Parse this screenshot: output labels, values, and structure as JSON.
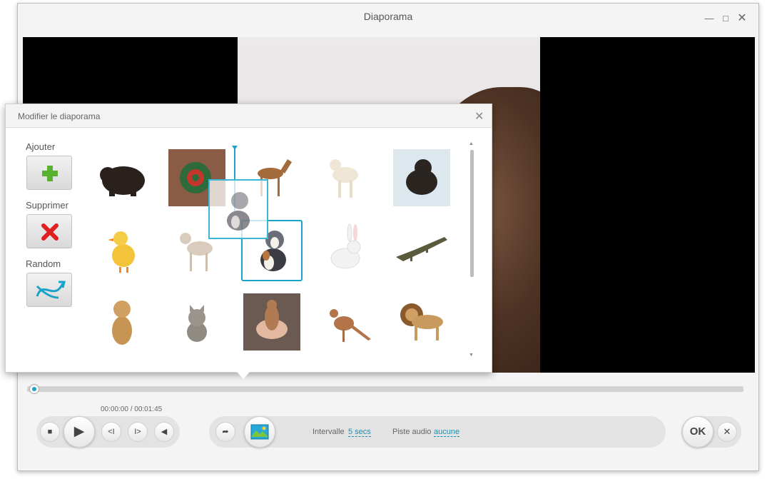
{
  "window": {
    "title": "Diaporama"
  },
  "dialog": {
    "title": "Modifier le diaporama",
    "sidebar": {
      "add_label": "Ajouter",
      "delete_label": "Supprimer",
      "random_label": "Random"
    },
    "thumbnails": [
      {
        "name": "bear"
      },
      {
        "name": "snake"
      },
      {
        "name": "foal"
      },
      {
        "name": "lamb"
      },
      {
        "name": "bear-cub"
      },
      {
        "name": "duckling"
      },
      {
        "name": "goat-kid"
      },
      {
        "name": "puppy"
      },
      {
        "name": "rabbit"
      },
      {
        "name": "crocodile"
      },
      {
        "name": "lion-cub"
      },
      {
        "name": "kitten"
      },
      {
        "name": "squirrel"
      },
      {
        "name": "kangaroo"
      },
      {
        "name": "lion"
      }
    ],
    "drag": {
      "item": "puppy"
    }
  },
  "player": {
    "time": "00:00:00 / 00:01:45",
    "progress": 0.0,
    "interval_label": "Intervalle",
    "interval_value": "5 secs",
    "audio_label": "Piste audio",
    "audio_value": "aucune",
    "ok_label": "OK"
  },
  "colors": {
    "accent": "#1aa3c9",
    "delete": "#e02020",
    "add": "#5ab031"
  }
}
